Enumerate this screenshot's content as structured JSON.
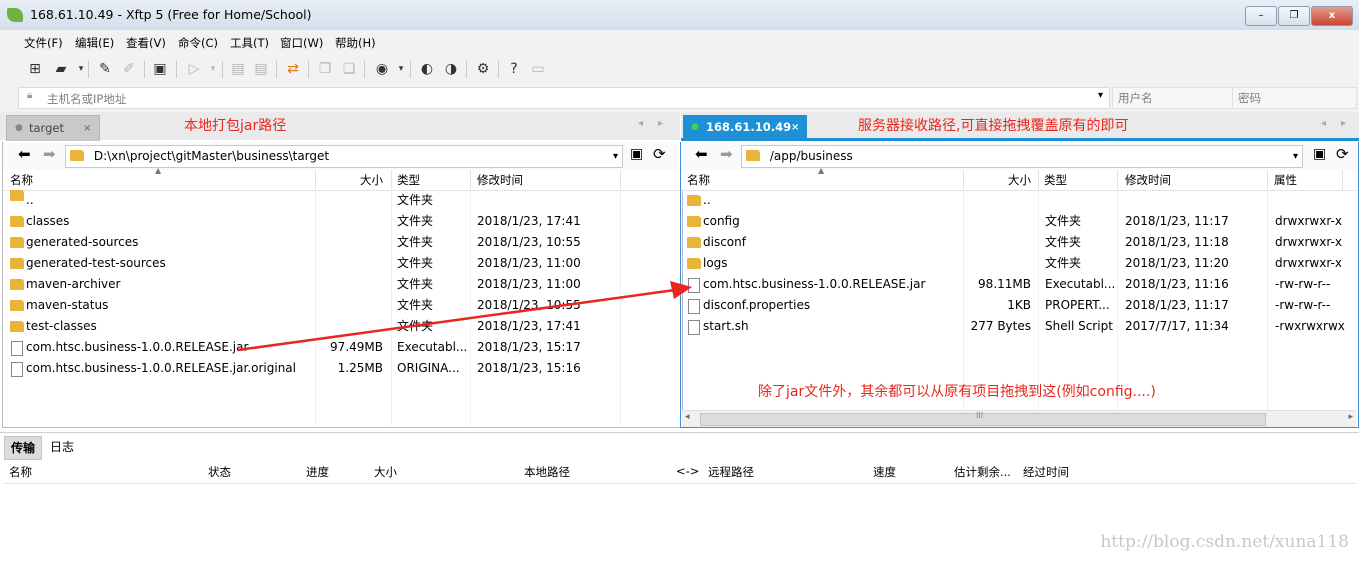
{
  "window": {
    "title": "168.61.10.49   - Xftp 5 (Free for Home/School)",
    "min": "–",
    "max": "❐",
    "close": "x"
  },
  "menu": [
    "文件(F)",
    "编辑(E)",
    "查看(V)",
    "命令(C)",
    "工具(T)",
    "窗口(W)",
    "帮助(H)"
  ],
  "address": {
    "host_placeholder": "主机名或IP地址",
    "user_placeholder": "用户名",
    "pass_placeholder": "密码",
    "dropdown": "▾"
  },
  "left": {
    "tab": "target",
    "note": "本地打包jar路径",
    "path": "D:\\xn\\project\\gitMaster\\business\\target",
    "headers": {
      "name": "名称",
      "size": "大小",
      "type": "类型",
      "mtime": "修改时间"
    },
    "rows": [
      {
        "name": "..",
        "size": "",
        "type": "文件夹",
        "mtime": "",
        "kind": "folder"
      },
      {
        "name": "classes",
        "size": "",
        "type": "文件夹",
        "mtime": "2018/1/23, 17:41",
        "kind": "folder"
      },
      {
        "name": "generated-sources",
        "size": "",
        "type": "文件夹",
        "mtime": "2018/1/23, 10:55",
        "kind": "folder"
      },
      {
        "name": "generated-test-sources",
        "size": "",
        "type": "文件夹",
        "mtime": "2018/1/23, 11:00",
        "kind": "folder"
      },
      {
        "name": "maven-archiver",
        "size": "",
        "type": "文件夹",
        "mtime": "2018/1/23, 11:00",
        "kind": "folder"
      },
      {
        "name": "maven-status",
        "size": "",
        "type": "文件夹",
        "mtime": "2018/1/23, 10:55",
        "kind": "folder"
      },
      {
        "name": "test-classes",
        "size": "",
        "type": "文件夹",
        "mtime": "2018/1/23, 17:41",
        "kind": "folder"
      },
      {
        "name": "com.htsc.business-1.0.0.RELEASE.jar",
        "size": "97.49MB",
        "type": "Executabl...",
        "mtime": "2018/1/23, 15:17",
        "kind": "file"
      },
      {
        "name": "com.htsc.business-1.0.0.RELEASE.jar.original",
        "size": "1.25MB",
        "type": "ORIGINA...",
        "mtime": "2018/1/23, 15:16",
        "kind": "file"
      }
    ]
  },
  "right": {
    "tab": "168.61.10.49",
    "note": "服务器接收路径,可直接拖拽覆盖原有的即可",
    "path": "/app/business",
    "headers": {
      "name": "名称",
      "size": "大小",
      "type": "类型",
      "mtime": "修改时间",
      "attr": "属性"
    },
    "rows": [
      {
        "name": "..",
        "size": "",
        "type": "",
        "mtime": "",
        "attr": "",
        "kind": "folder"
      },
      {
        "name": "config",
        "size": "",
        "type": "文件夹",
        "mtime": "2018/1/23, 11:17",
        "attr": "drwxrwxr-x",
        "kind": "folder"
      },
      {
        "name": "disconf",
        "size": "",
        "type": "文件夹",
        "mtime": "2018/1/23, 11:18",
        "attr": "drwxrwxr-x",
        "kind": "folder"
      },
      {
        "name": "logs",
        "size": "",
        "type": "文件夹",
        "mtime": "2018/1/23, 11:20",
        "attr": "drwxrwxr-x",
        "kind": "folder"
      },
      {
        "name": "com.htsc.business-1.0.0.RELEASE.jar",
        "size": "98.11MB",
        "type": "Executabl...",
        "mtime": "2018/1/23, 11:16",
        "attr": "-rw-rw-r--",
        "kind": "file"
      },
      {
        "name": "disconf.properties",
        "size": "1KB",
        "type": "PROPERT...",
        "mtime": "2018/1/23, 11:17",
        "attr": "-rw-rw-r--",
        "kind": "file"
      },
      {
        "name": "start.sh",
        "size": "277 Bytes",
        "type": "Shell Script",
        "mtime": "2017/7/17, 11:34",
        "attr": "-rwxrwxrwx",
        "kind": "file"
      }
    ],
    "bottom_note": "除了jar文件外，其余都可以从原有项目拖拽到这(例如config....)"
  },
  "transfer": {
    "tabs": [
      "传输",
      "日志"
    ],
    "headers": [
      "名称",
      "状态",
      "进度",
      "大小",
      "本地路径",
      "<->",
      "远程路径",
      "速度",
      "估计剩余...",
      "经过时间"
    ]
  },
  "watermark": "http://blog.csdn.net/xuna118",
  "colors": {
    "accent": "#1e90d6",
    "annotation": "#e8281e",
    "folder": "#e8b43a"
  }
}
